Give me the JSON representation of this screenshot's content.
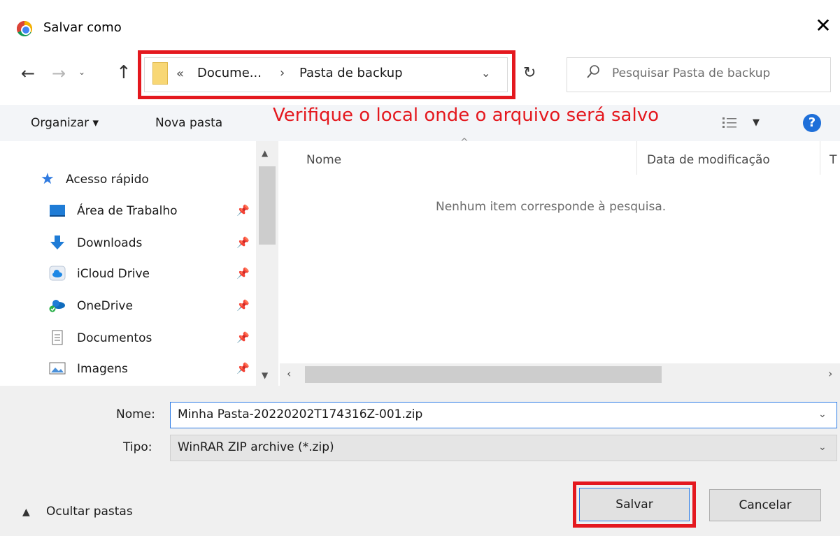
{
  "window": {
    "title": "Salvar como",
    "close_glyph": "✕"
  },
  "nav": {
    "back_glyph": "←",
    "forward_glyph": "→",
    "recent_glyph": "⌄",
    "up_glyph": "↑",
    "address": {
      "chevron": "«",
      "segment1": "Docume...",
      "separator": "›",
      "segment2": "Pasta de backup",
      "dropdown": "⌄"
    },
    "refresh_glyph": "↻",
    "search_placeholder": "Pesquisar Pasta de backup"
  },
  "toolbar": {
    "organize": "Organizar ▾",
    "new_folder": "Nova pasta",
    "annotation": "Verifique o local onde o arquivo será salvo",
    "view_dropdown": "▼",
    "help": "?"
  },
  "navpane": {
    "quick_access": "Acesso rápido",
    "items": [
      {
        "label": "Área de Trabalho",
        "icon": "desktop-icon"
      },
      {
        "label": "Downloads",
        "icon": "downloads-icon"
      },
      {
        "label": "iCloud Drive",
        "icon": "icloud-icon"
      },
      {
        "label": "OneDrive",
        "icon": "onedrive-icon"
      },
      {
        "label": "Documentos",
        "icon": "documents-icon"
      },
      {
        "label": "Imagens",
        "icon": "pictures-icon"
      }
    ],
    "pin_glyph": "📌"
  },
  "filelist": {
    "columns": [
      "Nome",
      "Data de modificação",
      "T"
    ],
    "sort_glyph": "^",
    "empty_message": "Nenhum item corresponde à pesquisa."
  },
  "form": {
    "name_label": "Nome:",
    "name_value": "Minha Pasta-20220202T174316Z-001.zip",
    "type_label": "Tipo:",
    "type_value": "WinRAR ZIP archive (*.zip)"
  },
  "footer": {
    "hide_folders": "Ocultar pastas",
    "save": "Salvar",
    "cancel": "Cancelar"
  },
  "colors": {
    "highlight": "#e4181e",
    "accent": "#2c7be5"
  }
}
